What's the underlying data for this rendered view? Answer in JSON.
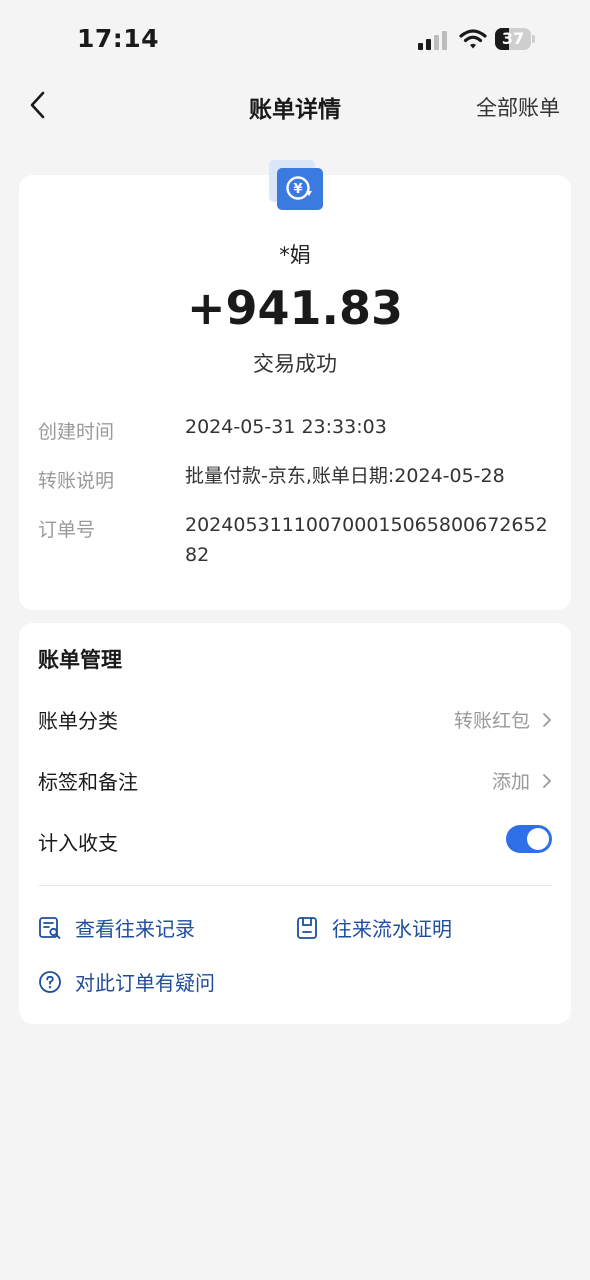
{
  "status_bar": {
    "time": "17:14",
    "battery_level": "37",
    "icons": [
      "signal-icon",
      "wifi-icon",
      "battery-icon"
    ]
  },
  "nav": {
    "title": "账单详情",
    "right_link": "全部账单",
    "back_icon": "chevron-left-icon"
  },
  "transaction": {
    "payee_icon": "transfer-yuan-icon",
    "payee_name": "*娟",
    "amount": "+941.83",
    "status": "交易成功",
    "details": [
      {
        "label": "创建时间",
        "value": "2024-05-31 23:33:03"
      },
      {
        "label": "转账说明",
        "value": "批量付款-京东,账单日期:2024-05-28"
      },
      {
        "label": "订单号",
        "value": "20240531110070001506580067265282"
      }
    ]
  },
  "manage": {
    "title": "账单管理",
    "category": {
      "label": "账单分类",
      "value": "转账红包"
    },
    "tags": {
      "label": "标签和备注",
      "value": "添加"
    },
    "count_in": {
      "label": "计入收支",
      "enabled": true
    },
    "links": {
      "history": "查看往来记录",
      "proof": "往来流水证明",
      "question": "对此订单有疑问"
    }
  },
  "colors": {
    "accent": "#2f6fe8",
    "link": "#1f4e9c",
    "background": "#f4f4f4",
    "muted": "#9a9a9a"
  }
}
